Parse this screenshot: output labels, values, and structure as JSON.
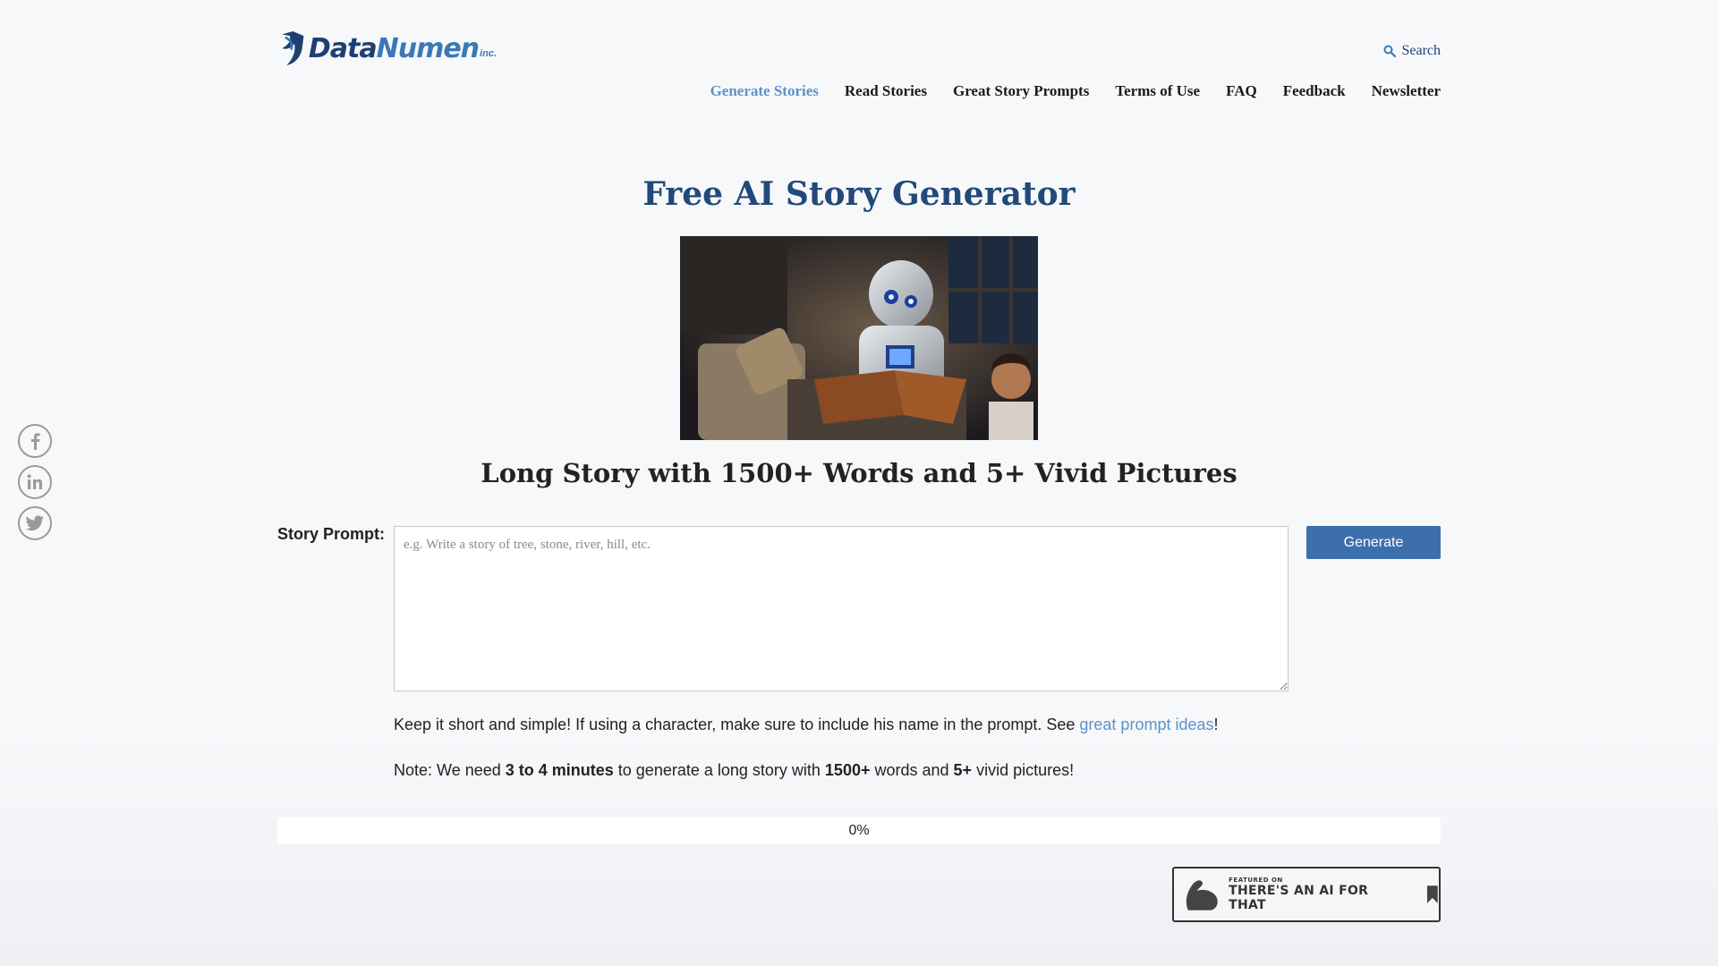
{
  "brand": {
    "name_part1": "Data",
    "name_part2": "Numen",
    "suffix": "inc."
  },
  "header": {
    "search_label": "Search"
  },
  "nav": {
    "items": [
      {
        "label": "Generate Stories",
        "active": true
      },
      {
        "label": "Read Stories"
      },
      {
        "label": "Great Story Prompts"
      },
      {
        "label": "Terms of Use"
      },
      {
        "label": "FAQ"
      },
      {
        "label": "Feedback"
      },
      {
        "label": "Newsletter"
      }
    ]
  },
  "social": [
    "facebook-icon",
    "linkedin-icon",
    "twitter-icon"
  ],
  "main": {
    "title": "Free AI Story Generator",
    "subtitle": "Long Story with 1500+ Words and 5+ Vivid Pictures",
    "prompt_label": "Story Prompt:",
    "prompt_placeholder": "e.g. Write a story of tree, stone, river, hill, etc.",
    "prompt_value": "",
    "generate_label": "Generate",
    "hint_text": "Keep it short and simple! If using a character, make sure to include his name in the prompt. See ",
    "hint_link": "great prompt ideas",
    "hint_end": "!",
    "note_prefix": "Note: We need ",
    "note_b1": "3 to 4 minutes",
    "note_mid1": " to generate a long story with ",
    "note_b2": "1500+",
    "note_mid2": " words and ",
    "note_b3": "5+",
    "note_end": " vivid pictures!",
    "progress_label": "0%",
    "progress_fraction": 0
  },
  "badge": {
    "line1": "FEATURED ON",
    "line2": "THERE'S AN AI FOR THAT"
  },
  "colors": {
    "accent": "#5b93c9",
    "title": "#22497a",
    "button": "#3e6fad",
    "brand_dark": "#1e3f72"
  }
}
